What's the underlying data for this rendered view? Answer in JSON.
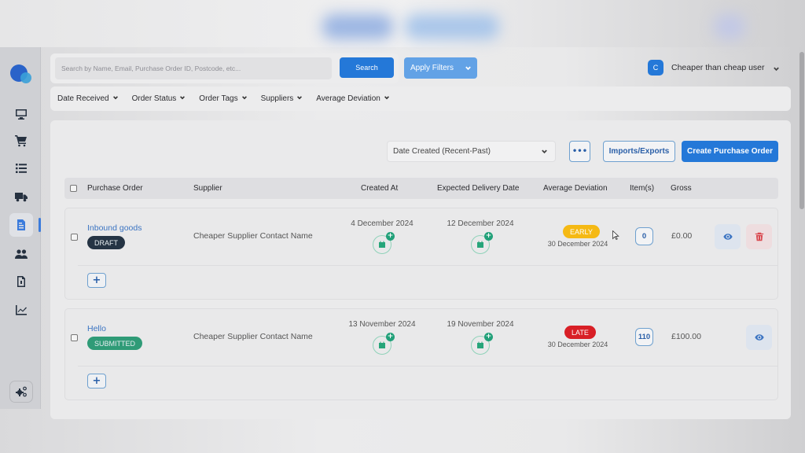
{
  "search": {
    "placeholder": "Search by Name, Email, Purchase Order ID, Postcode, etc...",
    "value": "",
    "button_label": "Search"
  },
  "apply_filters": {
    "label": "Apply Filters"
  },
  "user": {
    "initial": "C",
    "name": "Cheaper than cheap user"
  },
  "filters": [
    "Date Received",
    "Order Status",
    "Order Tags",
    "Suppliers",
    "Average Deviation"
  ],
  "sidebar": {
    "items": [
      {
        "name": "dashboard",
        "icon": "monitor-icon"
      },
      {
        "name": "orders",
        "icon": "cart-icon"
      },
      {
        "name": "lists",
        "icon": "list-icon"
      },
      {
        "name": "shipping",
        "icon": "truck-icon"
      },
      {
        "name": "purchase-orders",
        "icon": "document-icon",
        "active": true
      },
      {
        "name": "customers",
        "icon": "users-icon"
      },
      {
        "name": "invoices",
        "icon": "file-icon"
      },
      {
        "name": "reports",
        "icon": "chart-icon"
      }
    ],
    "settings_icon": "cogs-icon"
  },
  "toolbar": {
    "sort_value": "Date Created (Recent-Past)",
    "more_label": "•••",
    "imports_label": "Imports/Exports",
    "create_label": "Create Purchase Order"
  },
  "table": {
    "columns": [
      "Purchase Order",
      "Supplier",
      "Created At",
      "Expected Delivery Date",
      "Average Deviation",
      "Item(s)",
      "Gross"
    ],
    "rows": [
      {
        "name": "Inbound goods",
        "status": "DRAFT",
        "status_color": "#253444",
        "supplier": "Cheaper Supplier Contact Name",
        "created_at": "4 December 2024",
        "expected_delivery": "12 December 2024",
        "deviation_label": "EARLY",
        "deviation_color": "#f5b914",
        "deviation_date": "30 December 2024",
        "items": "0",
        "gross": "£0.00",
        "actions": [
          "view",
          "delete"
        ],
        "add_label": "+"
      },
      {
        "name": "Hello",
        "status": "SUBMITTED",
        "status_color": "#2f9b77",
        "supplier": "Cheaper Supplier Contact Name",
        "created_at": "13 November 2024",
        "expected_delivery": "19 November 2024",
        "deviation_label": "LATE",
        "deviation_color": "#d81f26",
        "deviation_date": "30 December 2024",
        "items": "110",
        "gross": "£100.00",
        "actions": [
          "view"
        ],
        "add_label": "+"
      }
    ]
  }
}
